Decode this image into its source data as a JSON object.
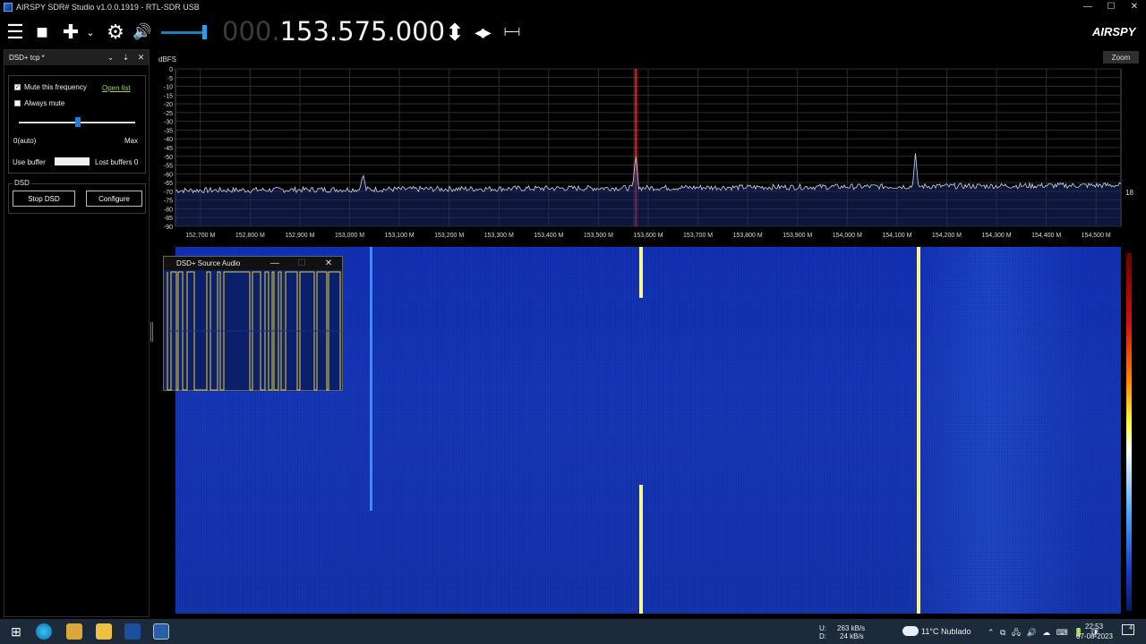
{
  "window": {
    "title": "AIRSPY SDR# Studio v1.0.0.1919 - RTL-SDR USB",
    "minimize": "—",
    "maximize": "☐",
    "close": "✕"
  },
  "toolbar": {
    "menu_icon": "☰",
    "stop_icon": "■",
    "add_icon": "✚",
    "add_dropdown_icon": "⌄",
    "settings_icon": "⚙",
    "volume_icon": "🔊",
    "tune_updown_icon": "⬍",
    "tune_leftright_icon": "◀▶",
    "bandwidth_icon": "⊢⊣",
    "logo": "AIRSPY",
    "frequency_dim": "000.",
    "frequency_bright": "153.575.000"
  },
  "left_panel": {
    "title": "DSD+ tcp *",
    "header_icons": [
      "⌄",
      "⇣",
      "✕"
    ],
    "mute_frequency": "Mute this frequency",
    "mute_frequency_checked": true,
    "open_list": "Open list",
    "always_mute": "Always mute",
    "always_mute_checked": false,
    "slider_min": "0(auto)",
    "slider_max": "Max",
    "use_buffer": "Use buffer",
    "lost_buffers": "Lost buffers 0",
    "dsd_group": "DSD",
    "stop_dsd": "Stop DSD",
    "configure": "Configure"
  },
  "spectrum": {
    "unit": "dBFS",
    "zoom": "Zoom",
    "side_number": "18",
    "y_ticks": [
      "0",
      "-5",
      "-10",
      "-15",
      "-20",
      "-25",
      "-30",
      "-35",
      "-40",
      "-45",
      "-50",
      "-55",
      "-60",
      "-65",
      "-70",
      "-75",
      "-80",
      "-85",
      "-90"
    ],
    "x_ticks": [
      "152,700 M",
      "152,800 M",
      "152,900 M",
      "153,000 M",
      "153,100 M",
      "153,200 M",
      "153,300 M",
      "153,400 M",
      "153,500 M",
      "153,600 M",
      "153,700 M",
      "153,800 M",
      "153,900 M",
      "154,000 M",
      "154,100 M",
      "154,200 M",
      "154,300 M",
      "154,400 M",
      "154,500 M"
    ],
    "tuned_mhz": 153.575,
    "noise_floor_dbfs": -68,
    "peaks": [
      {
        "mhz": 153.027,
        "dbfs": -60
      },
      {
        "mhz": 153.575,
        "dbfs": -48
      },
      {
        "mhz": 154.137,
        "dbfs": -48
      }
    ]
  },
  "audio_window": {
    "title": "DSD+ Source Audio",
    "minimize": "—",
    "maximize": "☐",
    "close": "✕"
  },
  "taskbar": {
    "upload_label": "U:",
    "upload_value": "263 kB/s",
    "download_label": "D:",
    "download_value": "24 kB/s",
    "weather": "11°C  Nublado",
    "time": "22:53",
    "date": "07-08-2023",
    "notification_count": "4",
    "start_icon": "⊞",
    "tray_icons": "⌃ ⧉ 🖧 🔊 ☁ ⌨ 🔋 🛡"
  }
}
